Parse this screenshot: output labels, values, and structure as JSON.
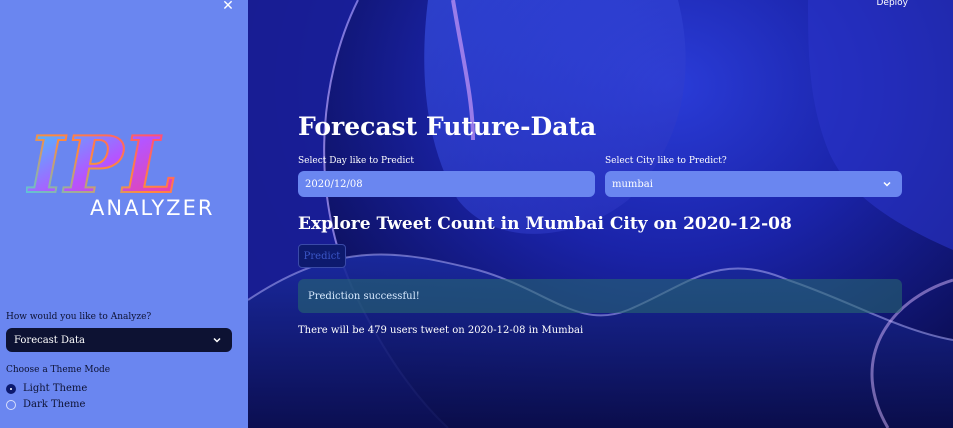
{
  "sidebar": {
    "close_icon": "close-icon",
    "logo": {
      "main": "IPL",
      "word": "ANALYZER",
      "colors": [
        "#ff3a8c",
        "#35d1ff",
        "#b455ff"
      ]
    },
    "analyze_label": "How would you like to Analyze?",
    "analyze_value": "Forecast Data",
    "theme_label": "Choose a Theme Mode",
    "themes": [
      {
        "label": "Light Theme",
        "selected": true
      },
      {
        "label": "Dark Theme",
        "selected": false
      }
    ],
    "bg_color": "#6a86f0"
  },
  "header": {
    "deploy_label": "Deploy"
  },
  "main": {
    "title": "Forecast Future-Data",
    "day_label": "Select Day like to Predict",
    "day_value": "2020/12/08",
    "city_label": "Select City like to Predict?",
    "city_value": "mumbai",
    "subtitle": "Explore Tweet Count in Mumbai City on 2020-12-08",
    "predict_label": "Predict",
    "success_message": "Prediction successful!",
    "result_text": "There will be 479 users tweet on 2020-12-08 in Mumbai"
  }
}
